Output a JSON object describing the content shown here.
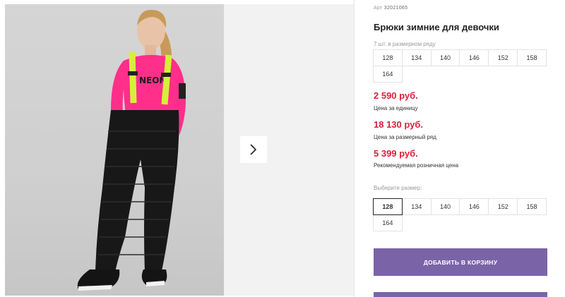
{
  "product": {
    "sku_label": "Арт",
    "sku_value": "32021065",
    "title": "Брюки зимние для девочки"
  },
  "pack": {
    "label": "7 шт. в размерном ряду",
    "sizes": [
      "128",
      "134",
      "140",
      "146",
      "152",
      "158",
      "164"
    ]
  },
  "prices": {
    "unit_price": "2 590 руб.",
    "unit_label": "Цена за единицу",
    "pack_price": "18 130 руб.",
    "pack_label": "Цена за размерный ряд",
    "retail_price": "5 399 руб.",
    "retail_label": "Рекомендуемая розничная цена"
  },
  "size_select": {
    "label": "Выберите размер:",
    "sizes": [
      "128",
      "134",
      "140",
      "146",
      "152",
      "158",
      "164"
    ],
    "selected": "128"
  },
  "cart": {
    "add_label": "ДОБАВИТЬ В КОРЗИНУ"
  },
  "gallery": {
    "next_icon": "chevron-right-icon",
    "shirt_print": "NEON"
  },
  "colors": {
    "price": "#d8213a",
    "button": "#7b63a8",
    "shirt": "#ff2f8a",
    "suspenders": "#d6f03a"
  }
}
